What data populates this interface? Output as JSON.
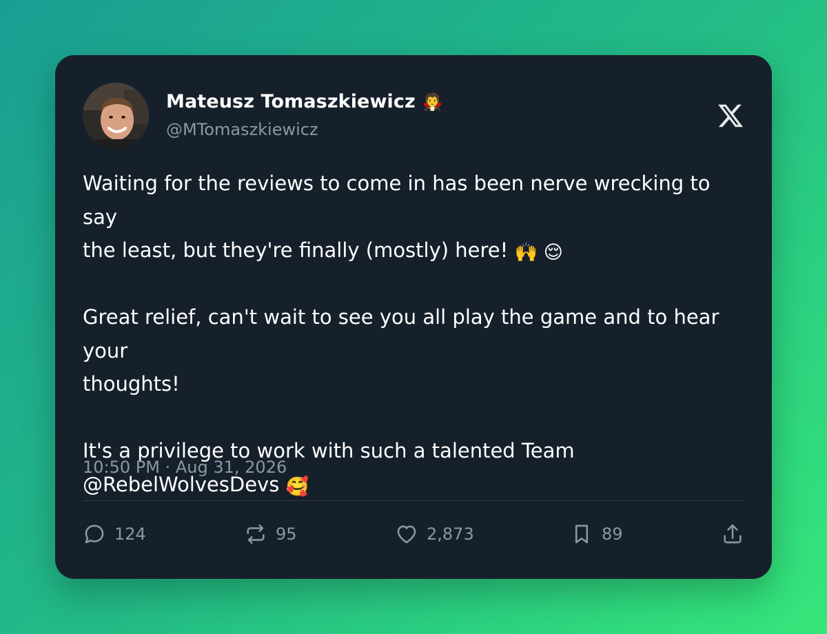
{
  "author": {
    "name": "Mateusz Tomaszkiewicz",
    "name_emoji": "🧛",
    "handle": "@MTomaszkiewicz"
  },
  "tweet": {
    "line1": "Waiting for the reviews to come in has been nerve wrecking to say",
    "line2": "the least, but they're finally (mostly) here!",
    "line2_emojis": "🙌 😌",
    "line3": "Great relief, can't wait to see you all play the game and to hear your",
    "line4": "thoughts!",
    "line5": "It's a privilege to work with such a talented Team",
    "line6": "@RebelWolvesDevs",
    "line6_emoji": "🥰",
    "timestamp": "10:50 PM · Aug 31, 2026"
  },
  "actions": {
    "replies": "124",
    "retweets": "95",
    "likes": "2,873",
    "bookmarks": "89"
  },
  "colors": {
    "card_bg": "#16202b",
    "text_primary": "#ffffff",
    "text_secondary": "#8b98a5",
    "divider": "#2f3a46"
  },
  "icons": [
    "avatar",
    "x-logo-icon",
    "reply-icon",
    "retweet-icon",
    "like-icon",
    "bookmark-icon",
    "share-icon"
  ]
}
